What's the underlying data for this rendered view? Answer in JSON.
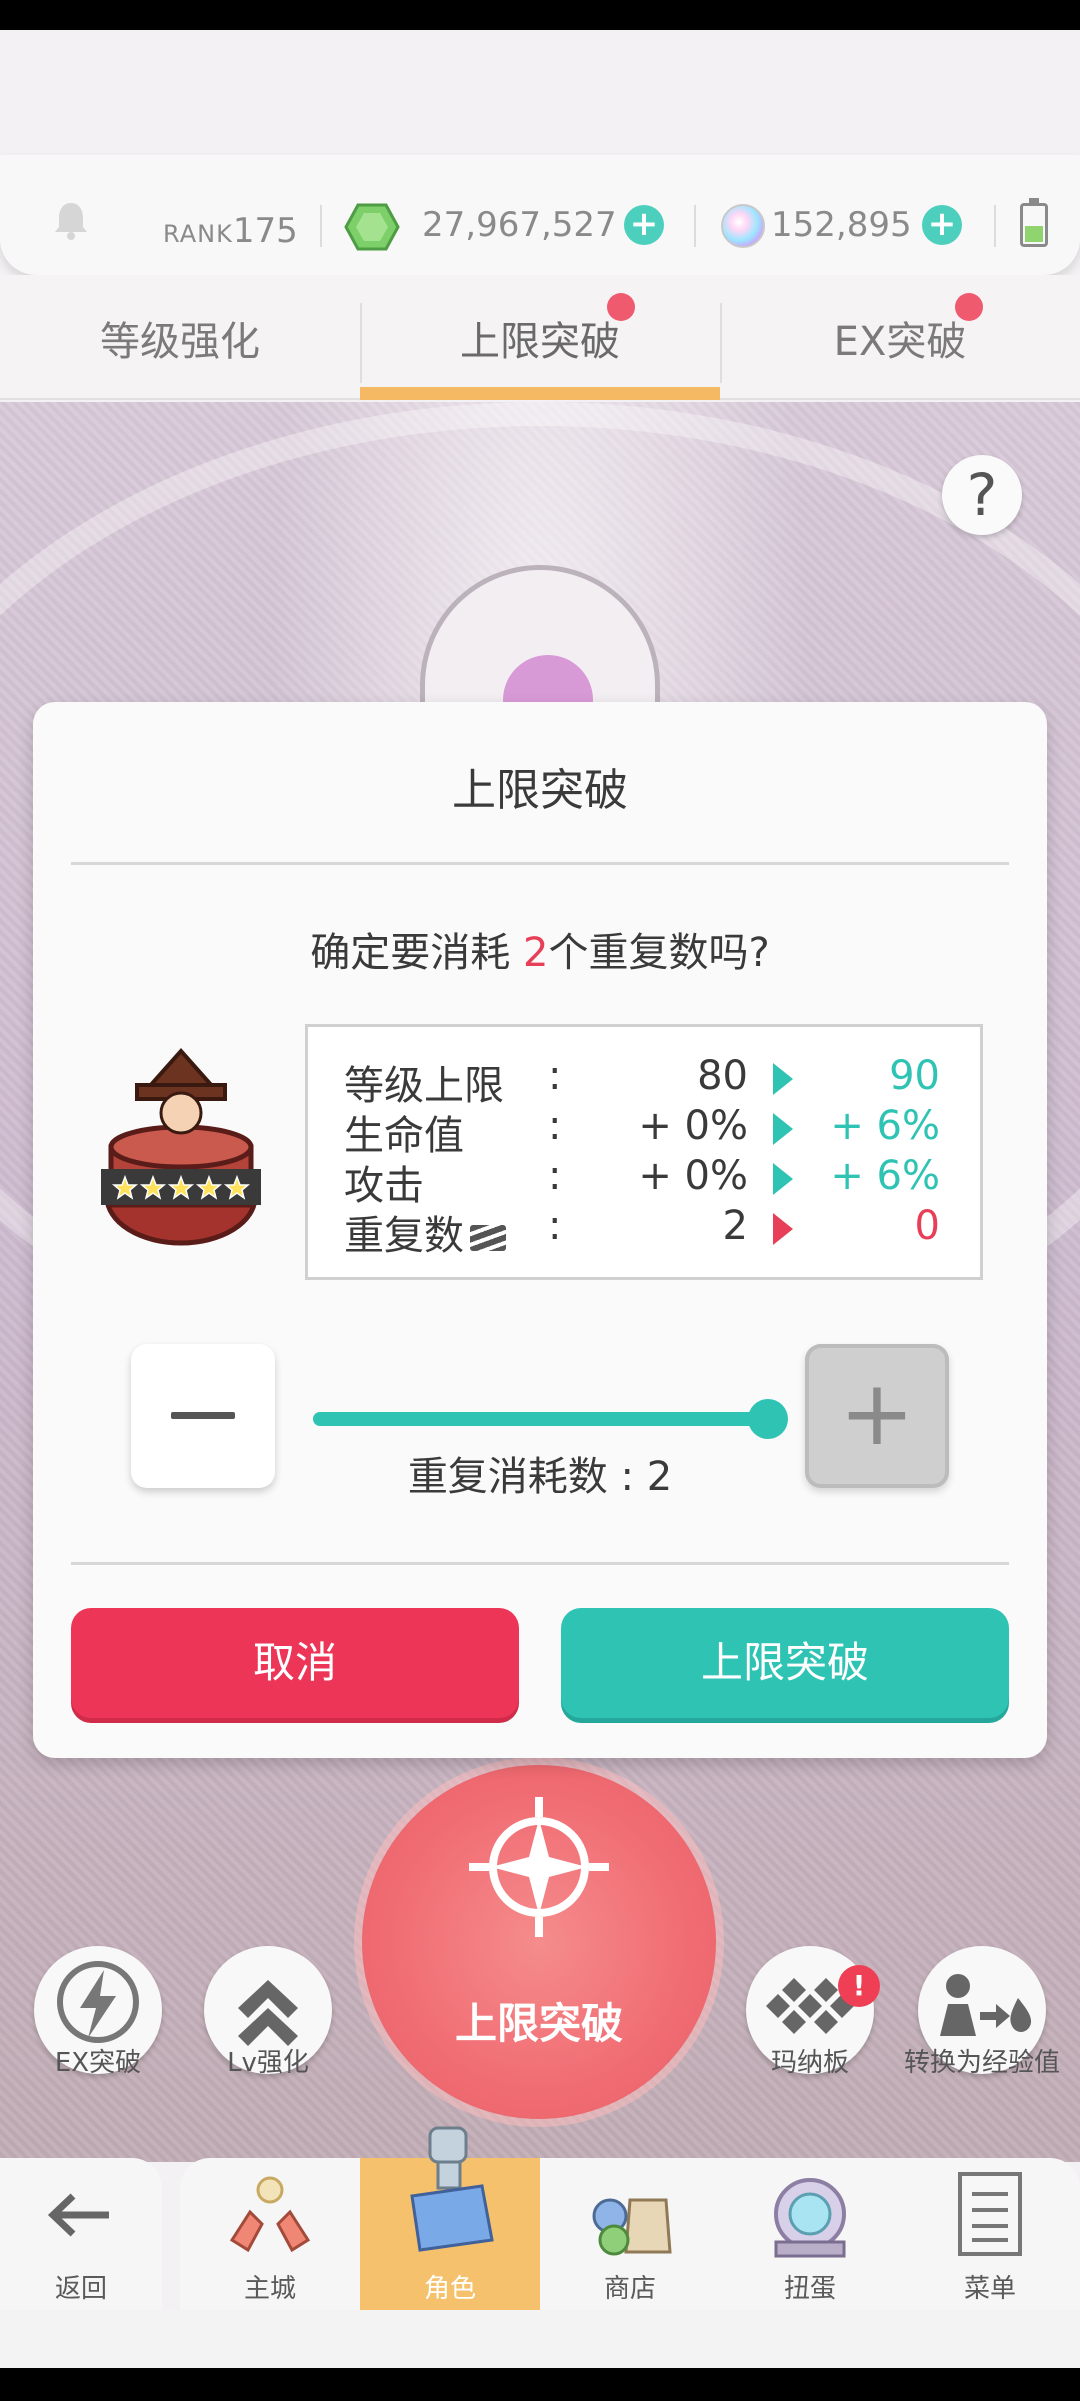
{
  "status": {
    "rank_label": "RANK",
    "rank_value": "175",
    "gems": "27,967,527",
    "orbs": "152,895"
  },
  "tabs": [
    {
      "label": "等级强化",
      "active": false
    },
    {
      "label": "上限突破",
      "active": true
    },
    {
      "label": "EX突破",
      "active": false
    }
  ],
  "dialog": {
    "title": "上限突破",
    "question_prefix": "确定要消耗 ",
    "question_count": "2",
    "question_suffix": "个重复数吗?",
    "stats": [
      {
        "label": "等级上限",
        "colon": ":",
        "from": "80",
        "to": "90",
        "direction": "up"
      },
      {
        "label": "生命值",
        "colon": ":",
        "from": "+ 0%",
        "to": "+ 6%",
        "direction": "up"
      },
      {
        "label": "攻击",
        "colon": ":",
        "from": "+ 0%",
        "to": "+ 6%",
        "direction": "up"
      },
      {
        "label": "重复数",
        "colon": ":",
        "from": "2",
        "to": "0",
        "direction": "down"
      }
    ],
    "slider": {
      "value": 2,
      "max": 2,
      "label": "重复消耗数 : 2"
    },
    "cancel_label": "取消",
    "confirm_label": "上限突破"
  },
  "big_action_label": "上限突破",
  "side_buttons": [
    {
      "label": "EX突破",
      "icon": "lightning-icon"
    },
    {
      "label": "Lv强化",
      "icon": "double-chevron-up-icon"
    },
    {
      "label": "玛纳板",
      "icon": "mana-board-icon"
    },
    {
      "label": "转换为经验值",
      "icon": "convert-exp-icon"
    }
  ],
  "side_badge": "!",
  "nav": [
    {
      "label": "返回",
      "icon": "back-arrow-icon"
    },
    {
      "label": "主城",
      "icon": "town-icon"
    },
    {
      "label": "角色",
      "icon": "character-icon"
    },
    {
      "label": "商店",
      "icon": "shop-icon"
    },
    {
      "label": "扭蛋",
      "icon": "gacha-icon"
    },
    {
      "label": "菜单",
      "icon": "menu-icon"
    }
  ],
  "colors": {
    "teal": "#2fc3b4",
    "red": "#ec3557",
    "tab_active": "#f6b963",
    "nav_active": "#f6c16c"
  }
}
